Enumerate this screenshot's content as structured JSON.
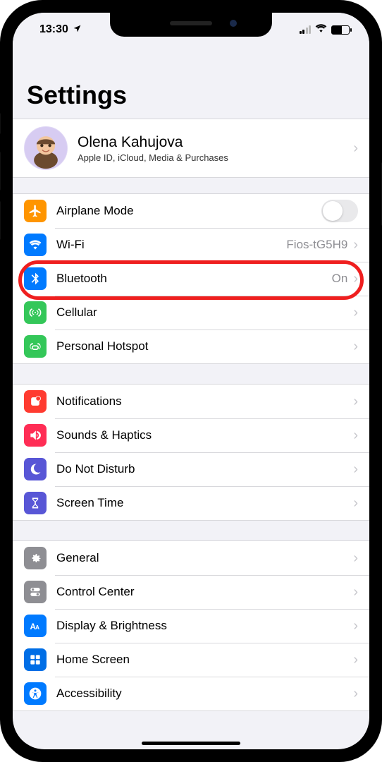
{
  "status_bar": {
    "time": "13:30",
    "location_icon": "location-arrow"
  },
  "title": "Settings",
  "account": {
    "name": "Olena Kahujova",
    "subtitle": "Apple ID, iCloud, Media & Purchases"
  },
  "group1": {
    "airplane": {
      "label": "Airplane Mode"
    },
    "wifi": {
      "label": "Wi-Fi",
      "detail": "Fios-tG5H9"
    },
    "bluetooth": {
      "label": "Bluetooth",
      "detail": "On"
    },
    "cellular": {
      "label": "Cellular"
    },
    "hotspot": {
      "label": "Personal Hotspot"
    }
  },
  "group2": {
    "notifications": {
      "label": "Notifications"
    },
    "sounds": {
      "label": "Sounds & Haptics"
    },
    "dnd": {
      "label": "Do Not Disturb"
    },
    "screentime": {
      "label": "Screen Time"
    }
  },
  "group3": {
    "general": {
      "label": "General"
    },
    "controlcenter": {
      "label": "Control Center"
    },
    "display": {
      "label": "Display & Brightness"
    },
    "homescreen": {
      "label": "Home Screen"
    },
    "accessibility": {
      "label": "Accessibility"
    }
  },
  "highlighted": "bluetooth"
}
